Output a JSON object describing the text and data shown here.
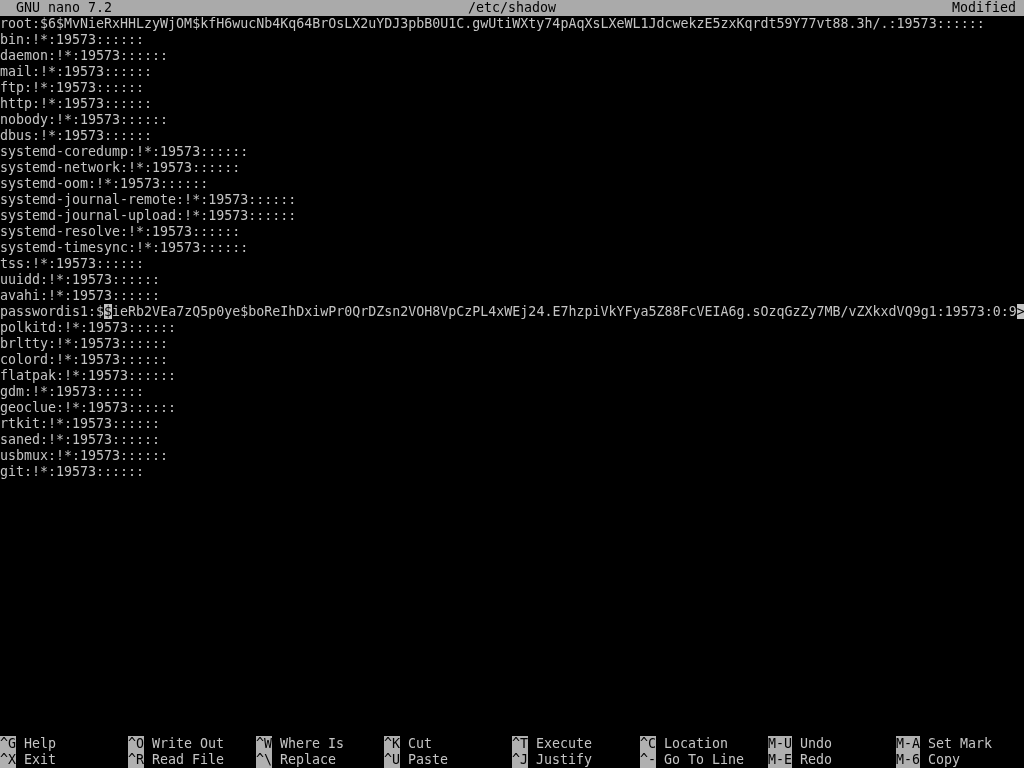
{
  "title_bar": {
    "app": "GNU nano 7.2",
    "file": "/etc/shadow",
    "status": "Modified"
  },
  "lines": [
    {
      "kind": "text",
      "text": "root:$6$MvNieRxHHLzyWjOM$kfH6wucNb4Kq64BrOsLX2uYDJ3pbB0U1C.gwUtiWXty74pAqXsLXeWL1JdcwekzE5zxKqrdt59Y77vt88.3h/.:19573::::::"
    },
    {
      "kind": "text",
      "text": "bin:!*:19573::::::"
    },
    {
      "kind": "text",
      "text": "daemon:!*:19573::::::"
    },
    {
      "kind": "text",
      "text": "mail:!*:19573::::::"
    },
    {
      "kind": "text",
      "text": "ftp:!*:19573::::::"
    },
    {
      "kind": "text",
      "text": "http:!*:19573::::::"
    },
    {
      "kind": "text",
      "text": "nobody:!*:19573::::::"
    },
    {
      "kind": "text",
      "text": "dbus:!*:19573::::::"
    },
    {
      "kind": "text",
      "text": "systemd-coredump:!*:19573::::::"
    },
    {
      "kind": "text",
      "text": "systemd-network:!*:19573::::::"
    },
    {
      "kind": "text",
      "text": "systemd-oom:!*:19573::::::"
    },
    {
      "kind": "text",
      "text": "systemd-journal-remote:!*:19573::::::"
    },
    {
      "kind": "text",
      "text": "systemd-journal-upload:!*:19573::::::"
    },
    {
      "kind": "text",
      "text": "systemd-resolve:!*:19573::::::"
    },
    {
      "kind": "text",
      "text": "systemd-timesync:!*:19573::::::"
    },
    {
      "kind": "text",
      "text": "tss:!*:19573::::::"
    },
    {
      "kind": "text",
      "text": "uuidd:!*:19573::::::"
    },
    {
      "kind": "text",
      "text": "avahi:!*:19573::::::"
    },
    {
      "kind": "cursor",
      "before": "passwordis1:$",
      "at": "$",
      "after": "ieRb2VEa7zQ5p0ye$boReIhDxiwPr0QrDZsn2VOH8VpCzPL4xWEj24.E7hzpiVkYFya5Z88FcVEIA6g.sOzqGzZy7MB/vZXkxdVQ9g1:19573:0:9",
      "overflow": ">"
    },
    {
      "kind": "text",
      "text": "polkitd:!*:19573::::::"
    },
    {
      "kind": "text",
      "text": "brltty:!*:19573::::::"
    },
    {
      "kind": "text",
      "text": "colord:!*:19573::::::"
    },
    {
      "kind": "text",
      "text": "flatpak:!*:19573::::::"
    },
    {
      "kind": "text",
      "text": "gdm:!*:19573::::::"
    },
    {
      "kind": "text",
      "text": "geoclue:!*:19573::::::"
    },
    {
      "kind": "text",
      "text": "rtkit:!*:19573::::::"
    },
    {
      "kind": "text",
      "text": "saned:!*:19573::::::"
    },
    {
      "kind": "text",
      "text": "usbmux:!*:19573::::::"
    },
    {
      "kind": "text",
      "text": "git:!*:19573::::::"
    }
  ],
  "shortcuts": [
    [
      {
        "key": "^G",
        "label": "Help"
      },
      {
        "key": "^O",
        "label": "Write Out"
      },
      {
        "key": "^W",
        "label": "Where Is"
      },
      {
        "key": "^K",
        "label": "Cut"
      },
      {
        "key": "^T",
        "label": "Execute"
      },
      {
        "key": "^C",
        "label": "Location"
      },
      {
        "key": "M-U",
        "label": "Undo"
      },
      {
        "key": "M-A",
        "label": "Set Mark"
      }
    ],
    [
      {
        "key": "^X",
        "label": "Exit"
      },
      {
        "key": "^R",
        "label": "Read File"
      },
      {
        "key": "^\\",
        "label": "Replace"
      },
      {
        "key": "^U",
        "label": "Paste"
      },
      {
        "key": "^J",
        "label": "Justify"
      },
      {
        "key": "^-",
        "label": "Go To Line"
      },
      {
        "key": "M-E",
        "label": "Redo"
      },
      {
        "key": "M-6",
        "label": "Copy"
      }
    ]
  ]
}
